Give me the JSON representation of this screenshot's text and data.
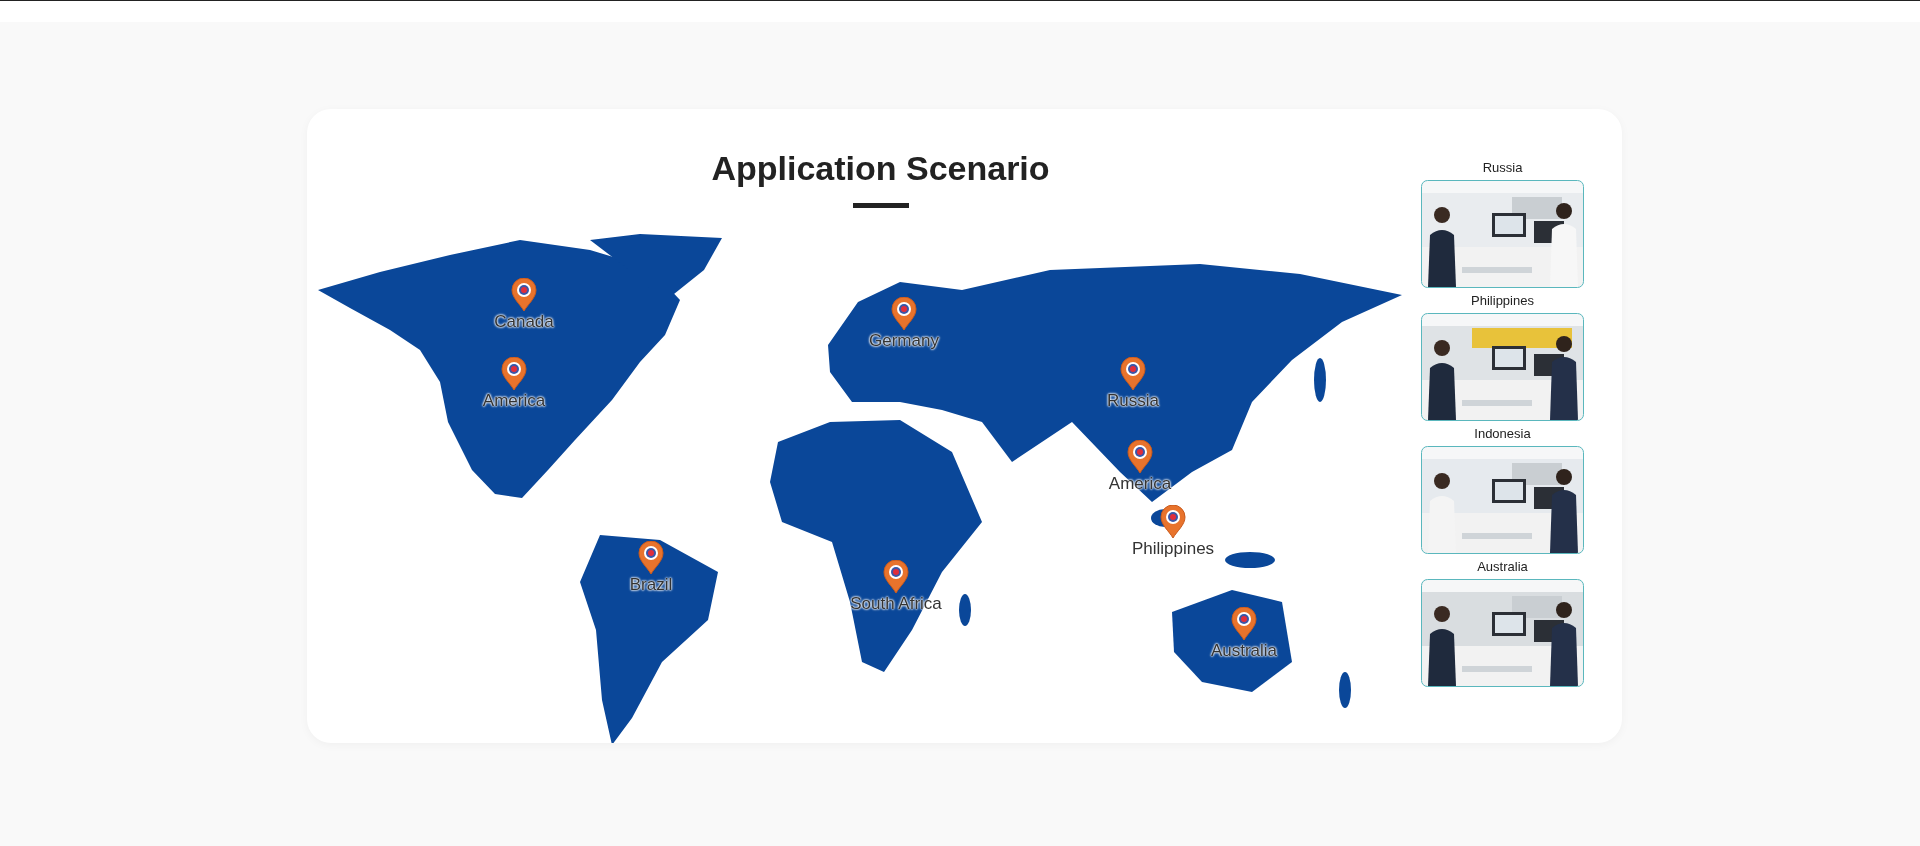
{
  "title": "Application Scenario",
  "map": {
    "markers": [
      {
        "label": "Canada"
      },
      {
        "label": "America"
      },
      {
        "label": "Germany"
      },
      {
        "label": "Russia"
      },
      {
        "label": "America"
      },
      {
        "label": "Philippines"
      },
      {
        "label": "Brazil"
      },
      {
        "label": "South Africa"
      },
      {
        "label": "Australia"
      }
    ]
  },
  "scenarios": [
    {
      "caption": "Russia"
    },
    {
      "caption": "Philippines"
    },
    {
      "caption": "Indonesia"
    },
    {
      "caption": "Australia"
    }
  ]
}
